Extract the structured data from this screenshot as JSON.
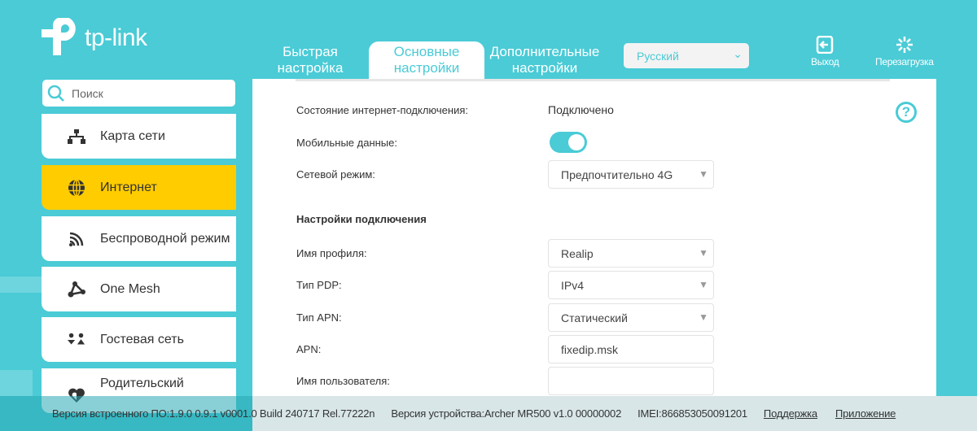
{
  "logo": {
    "text": "tp-link"
  },
  "header": {
    "tabs": [
      {
        "label": "Быстрая настройка"
      },
      {
        "label": "Основные настройки",
        "active": true
      },
      {
        "label": "Дополнительные настройки"
      }
    ],
    "language": "Русский",
    "logout": "Выход",
    "reboot": "Перезагрузка"
  },
  "sidebar": {
    "search_placeholder": "Поиск",
    "items": [
      {
        "label": "Карта сети",
        "icon": "network-map-icon"
      },
      {
        "label": "Интернет",
        "icon": "globe-icon",
        "active": true
      },
      {
        "label": "Беспроводной режим",
        "icon": "wireless-icon"
      },
      {
        "label": "One Mesh",
        "icon": "mesh-icon"
      },
      {
        "label": "Гостевая сеть",
        "icon": "guest-icon"
      },
      {
        "label": "Родительский",
        "icon": "parental-icon"
      }
    ]
  },
  "form": {
    "status_label": "Состояние интернет-подключения:",
    "status_value": "Подключено",
    "mobile_label": "Мобильные данные:",
    "mobile_on": true,
    "mode_label": "Сетевой режим:",
    "mode_value": "Предпочтительно 4G",
    "section_title": "Настройки подключения",
    "profile_label": "Имя профиля:",
    "profile_value": "Realip",
    "pdp_label": "Тип PDP:",
    "pdp_value": "IPv4",
    "apn_type_label": "Тип APN:",
    "apn_type_value": "Статический",
    "apn_label": "APN:",
    "apn_value": "fixedip.msk",
    "user_label": "Имя пользователя:",
    "user_value": ""
  },
  "footer": {
    "firmware": "Версия встроенного ПО:1.9.0 0.9.1 v0001.0 Build 240717 Rel.77222n",
    "hardware": "Версия устройства:Archer MR500 v1.0 00000002",
    "imei": "IMEI:866853050091201",
    "support": "Поддержка",
    "app": "Приложение"
  },
  "colors": {
    "accent": "#4acbd6",
    "active": "#ffcc00"
  }
}
